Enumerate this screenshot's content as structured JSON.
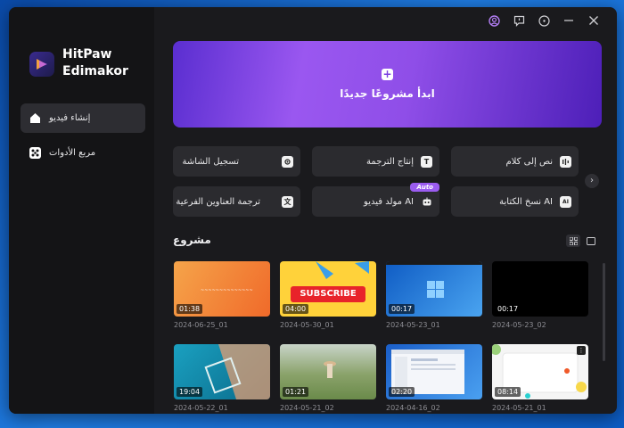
{
  "app": {
    "name_line1": "HitPaw",
    "name_line2": "Edimakor"
  },
  "sidebar": {
    "items": [
      {
        "label": "إنشاء فيديو",
        "active": true
      },
      {
        "label": "مربع الأدوات",
        "active": false
      }
    ]
  },
  "titlebar": {
    "icons": [
      "user-icon",
      "feedback-icon",
      "menu-icon",
      "minimize-icon",
      "close-icon"
    ]
  },
  "hero": {
    "label": "ابدأ مشروعًا جديدًا",
    "plus": "+"
  },
  "tools": [
    {
      "label": "نص إلى كلام",
      "icon": "text-to-speech-icon"
    },
    {
      "label": "إنتاج الترجمة",
      "icon": "subtitle-generation-icon",
      "glyph": "T"
    },
    {
      "label": "تسجيل الشاشة",
      "icon": "screen-record-icon"
    },
    {
      "label": "نسخ الكتابة AI",
      "icon": "ai-copywriting-icon",
      "glyph": "AI"
    },
    {
      "label": "مولد فيديو AI",
      "icon": "ai-video-generator-icon",
      "badge": "Auto"
    },
    {
      "label": "ترجمة العناوين الفرعية",
      "icon": "subtitle-translate-icon",
      "glyph": "文"
    }
  ],
  "section": {
    "title": "مشروع"
  },
  "projects": [
    {
      "name": "2024-06-25_01",
      "duration": "01:38",
      "thumb_color": "#f07a3a"
    },
    {
      "name": "2024-05-30_01",
      "duration": "04:00",
      "thumb_color": "#ffd23a",
      "thumb_text": "SUBSCRIBE"
    },
    {
      "name": "2024-05-23_01",
      "duration": "00:17",
      "thumb_color": "#1e78d8"
    },
    {
      "name": "2024-05-23_02",
      "duration": "00:17",
      "thumb_color": "#000000"
    },
    {
      "name": "2024-05-22_01",
      "duration": "19:04",
      "thumb_color": "#1a8fb0"
    },
    {
      "name": "2024-05-21_02",
      "duration": "01:21",
      "thumb_color": "#8aa26a"
    },
    {
      "name": "2024-04-16_02",
      "duration": "02:20",
      "thumb_color": "#2a6ecf"
    },
    {
      "name": "2024-05-21_01",
      "duration": "08:14",
      "thumb_color": "#f5f5f5"
    }
  ],
  "colors": {
    "accent": "#9b5cf0",
    "window_bg": "#1a1a1d",
    "sidebar_bg": "#141416",
    "tool_bg": "#2b2b2f"
  }
}
